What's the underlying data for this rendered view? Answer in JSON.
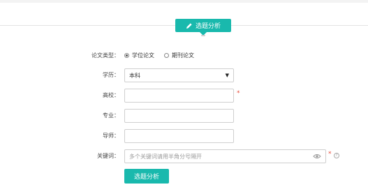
{
  "header": {
    "title": "选题分析",
    "icon": "pencil-icon"
  },
  "form": {
    "paper_type": {
      "label": "论文类型：",
      "options": [
        {
          "label": "学位论文",
          "checked": true
        },
        {
          "label": "期刊论文",
          "checked": false
        }
      ]
    },
    "degree": {
      "label": "学历：",
      "value": "本科"
    },
    "school": {
      "label": "高校：",
      "value": "",
      "required_mark": "*"
    },
    "major": {
      "label": "专业：",
      "value": ""
    },
    "advisor": {
      "label": "导师：",
      "value": ""
    },
    "keywords": {
      "label": "关键词：",
      "placeholder": "多个关键词请用半角分号隔开",
      "required_mark": "*",
      "help_icon": "?"
    },
    "submit_label": "选题分析"
  },
  "colors": {
    "accent": "#19b9ad",
    "required": "#e74c3c"
  }
}
